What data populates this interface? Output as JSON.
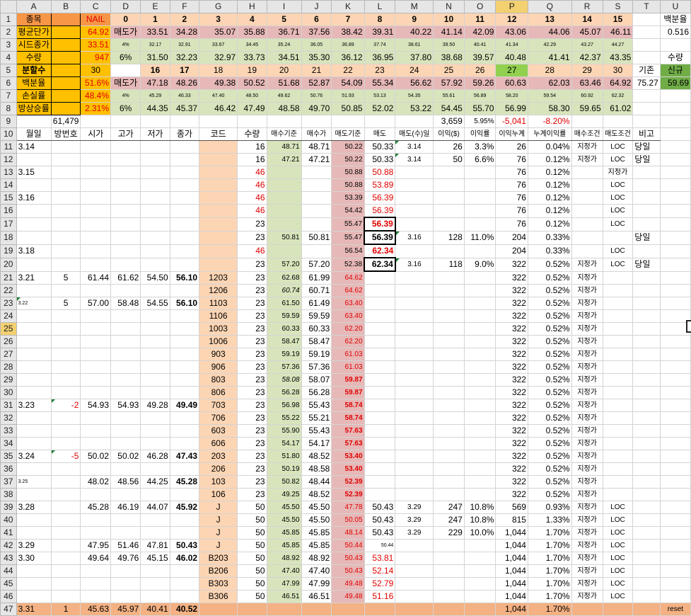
{
  "columns": [
    "A",
    "B",
    "C",
    "D",
    "E",
    "F",
    "G",
    "H",
    "I",
    "J",
    "K",
    "L",
    "M",
    "N",
    "O",
    "P",
    "Q",
    "R",
    "S",
    "T",
    "U"
  ],
  "selected_column": "P",
  "selected_row": "25",
  "colors": {
    "header_orange": "#f79646",
    "yellow": "#ffc000",
    "green": "#92d050",
    "red_text": "#e00000",
    "pink": "#e6b8b7",
    "light_green": "#d8e4bc",
    "peach": "#fcd5b4"
  },
  "rows": [
    {
      "n": "1",
      "c": [
        "종목",
        "",
        "NAIL",
        "0",
        "1",
        "2",
        "3",
        "4",
        "5",
        "6",
        "7",
        "8",
        "9",
        "10",
        "11",
        "12",
        "13",
        "14",
        "15",
        "",
        "백분율"
      ]
    },
    {
      "n": "2",
      "c": [
        "평균단가",
        "",
        "64.92",
        "매도가",
        "33.51",
        "34.28",
        "35.07",
        "35.88",
        "36.71",
        "37.56",
        "38.42",
        "39.31",
        "40.22",
        "41.14",
        "42.09",
        "43.06",
        "44.06",
        "45.07",
        "46.11",
        "",
        "0.516"
      ]
    },
    {
      "n": "3",
      "c": [
        "시드종가",
        "",
        "33.51",
        "4%",
        "32.17",
        "32.91",
        "33.67",
        "34.45",
        "35.24",
        "36.05",
        "36.89",
        "37.74",
        "38.61",
        "39.50",
        "40.41",
        "41.34",
        "42.29",
        "43.27",
        "44.27",
        "",
        ""
      ]
    },
    {
      "n": "4",
      "c": [
        "수량",
        "",
        "947",
        "6%",
        "31.50",
        "32.23",
        "32.97",
        "33.73",
        "34.51",
        "35.30",
        "36.12",
        "36.95",
        "37.80",
        "38.68",
        "39.57",
        "40.48",
        "41.41",
        "42.37",
        "43.35",
        "",
        "수량"
      ]
    },
    {
      "n": "5",
      "c": [
        "분할수",
        "",
        "30",
        "",
        "16",
        "17",
        "18",
        "19",
        "20",
        "21",
        "22",
        "23",
        "24",
        "25",
        "26",
        "27",
        "28",
        "29",
        "30",
        "기존",
        "신규"
      ]
    },
    {
      "n": "6",
      "c": [
        "백분율",
        "",
        "51.6%",
        "매도가",
        "47.18",
        "48.26",
        "49.38",
        "50.52",
        "51.68",
        "52.87",
        "54.09",
        "55.34",
        "56.62",
        "57.92",
        "59.26",
        "60.63",
        "62.03",
        "63.46",
        "64.92",
        "75.27",
        "59.69"
      ]
    },
    {
      "n": "7",
      "c": [
        "손실률",
        "",
        "48.4%",
        "4%",
        "45.29",
        "46.33",
        "47.40",
        "48.50",
        "49.62",
        "50.76",
        "51.93",
        "53.13",
        "54.35",
        "55.61",
        "56.89",
        "58.20",
        "59.54",
        "60.92",
        "62.32",
        "",
        ""
      ]
    },
    {
      "n": "8",
      "c": [
        "방상승률",
        "",
        "2.31%",
        "6%",
        "44.35",
        "45.37",
        "46.42",
        "47.49",
        "48.58",
        "49.70",
        "50.85",
        "52.02",
        "53.22",
        "54.45",
        "55.70",
        "56.99",
        "58.30",
        "59.65",
        "61.02",
        "",
        ""
      ]
    },
    {
      "n": "9",
      "c": [
        "",
        "61,479",
        "",
        "",
        "",
        "",
        "",
        "",
        "",
        "",
        "",
        "",
        "",
        "3,659",
        "5.95%",
        "-5,041",
        "-8.20%",
        "",
        "",
        "",
        ""
      ]
    },
    {
      "n": "10",
      "c": [
        "월일",
        "방번호",
        "시가",
        "고가",
        "저가",
        "종가",
        "코드",
        "수량",
        "매수기준",
        "매수가",
        "매도기준",
        "매도",
        "매도(수)일",
        "이익($)",
        "이익률",
        "이익누계",
        "누계이익률",
        "매수조건",
        "매도조건",
        "비고",
        ""
      ]
    },
    {
      "n": "11",
      "c": [
        "3.14",
        "",
        "",
        "",
        "",
        "",
        "",
        "16",
        "48.71",
        "48.71",
        "50.22",
        "50.33",
        "3.14",
        "26",
        "3.3%",
        "26",
        "0.04%",
        "지정가",
        "LOC",
        "당일",
        ""
      ]
    },
    {
      "n": "12",
      "c": [
        "",
        "",
        "",
        "",
        "",
        "",
        "",
        "16",
        "47.21",
        "47.21",
        "50.22",
        "50.33",
        "3.14",
        "50",
        "6.6%",
        "76",
        "0.12%",
        "지정가",
        "LOC",
        "당일",
        ""
      ]
    },
    {
      "n": "13",
      "c": [
        "3.15",
        "",
        "",
        "",
        "",
        "",
        "",
        "46",
        "",
        "",
        "50.88",
        "50.88",
        "",
        "",
        "",
        "76",
        "0.12%",
        "",
        "지정가",
        "",
        ""
      ]
    },
    {
      "n": "14",
      "c": [
        "",
        "",
        "",
        "",
        "",
        "",
        "",
        "46",
        "",
        "",
        "50.88",
        "53.89",
        "",
        "",
        "",
        "76",
        "0.12%",
        "",
        "LOC",
        "",
        ""
      ]
    },
    {
      "n": "15",
      "c": [
        "3.16",
        "",
        "",
        "",
        "",
        "",
        "",
        "46",
        "",
        "",
        "53.39",
        "56.39",
        "",
        "",
        "",
        "76",
        "0.12%",
        "",
        "LOC",
        "",
        ""
      ]
    },
    {
      "n": "16",
      "c": [
        "",
        "",
        "",
        "",
        "",
        "",
        "",
        "46",
        "",
        "",
        "54.42",
        "56.39",
        "",
        "",
        "",
        "76",
        "0.12%",
        "",
        "LOC",
        "",
        ""
      ]
    },
    {
      "n": "17",
      "c": [
        "",
        "",
        "",
        "",
        "",
        "",
        "",
        "23",
        "",
        "",
        "55.47",
        "56.39",
        "",
        "",
        "",
        "76",
        "0.12%",
        "",
        "LOC",
        "",
        ""
      ]
    },
    {
      "n": "18",
      "c": [
        "",
        "",
        "",
        "",
        "",
        "",
        "",
        "23",
        "50.81",
        "50.81",
        "55.47",
        "56.39",
        "3.16",
        "128",
        "11.0%",
        "204",
        "0.33%",
        "",
        "",
        "당일",
        ""
      ]
    },
    {
      "n": "19",
      "c": [
        "3.18",
        "",
        "",
        "",
        "",
        "",
        "",
        "46",
        "",
        "",
        "56.54",
        "62.34",
        "",
        "",
        "",
        "204",
        "0.33%",
        "",
        "LOC",
        "",
        ""
      ]
    },
    {
      "n": "20",
      "c": [
        "",
        "",
        "",
        "",
        "",
        "",
        "",
        "23",
        "57.20",
        "57.20",
        "52.38",
        "62.34",
        "3.16",
        "118",
        "9.0%",
        "322",
        "0.52%",
        "지정가",
        "LOC",
        "당일",
        ""
      ]
    },
    {
      "n": "21",
      "c": [
        "3.21",
        "5",
        "61.44",
        "61.62",
        "54.50",
        "56.10",
        "1203",
        "23",
        "62.68",
        "61.99",
        "64.62",
        "",
        "",
        "",
        "",
        "322",
        "0.52%",
        "지정가",
        "",
        "",
        ""
      ]
    },
    {
      "n": "22",
      "c": [
        "",
        "",
        "",
        "",
        "",
        "",
        "1206",
        "23",
        "60.74",
        "60.71",
        "64.62",
        "",
        "",
        "",
        "",
        "322",
        "0.52%",
        "지정가",
        "",
        "",
        ""
      ]
    },
    {
      "n": "23",
      "c": [
        "3.22",
        "5",
        "57.00",
        "58.48",
        "54.55",
        "56.10",
        "1103",
        "23",
        "61.50",
        "61.49",
        "63.40",
        "",
        "",
        "",
        "",
        "322",
        "0.52%",
        "지정가",
        "",
        "",
        ""
      ]
    },
    {
      "n": "24",
      "c": [
        "",
        "",
        "",
        "",
        "",
        "",
        "1106",
        "23",
        "59.59",
        "59.59",
        "63.40",
        "",
        "",
        "",
        "",
        "322",
        "0.52%",
        "지정가",
        "",
        "",
        ""
      ]
    },
    {
      "n": "25",
      "c": [
        "",
        "",
        "",
        "",
        "",
        "",
        "1003",
        "23",
        "60.33",
        "60.33",
        "62.20",
        "",
        "",
        "",
        "",
        "322",
        "0.52%",
        "지정가",
        "",
        "",
        ""
      ]
    },
    {
      "n": "26",
      "c": [
        "",
        "",
        "",
        "",
        "",
        "",
        "1006",
        "23",
        "58.47",
        "58.47",
        "62.20",
        "",
        "",
        "",
        "",
        "322",
        "0.52%",
        "지정가",
        "",
        "",
        ""
      ]
    },
    {
      "n": "27",
      "c": [
        "",
        "",
        "",
        "",
        "",
        "",
        "903",
        "23",
        "59.19",
        "59.19",
        "61.03",
        "",
        "",
        "",
        "",
        "322",
        "0.52%",
        "지정가",
        "",
        "",
        ""
      ]
    },
    {
      "n": "28",
      "c": [
        "",
        "",
        "",
        "",
        "",
        "",
        "906",
        "23",
        "57.36",
        "57.36",
        "61.03",
        "",
        "",
        "",
        "",
        "322",
        "0.52%",
        "지정가",
        "",
        "",
        ""
      ]
    },
    {
      "n": "29",
      "c": [
        "",
        "",
        "",
        "",
        "",
        "",
        "803",
        "23",
        "58.08",
        "58.07",
        "59.87",
        "",
        "",
        "",
        "",
        "322",
        "0.52%",
        "지정가",
        "",
        "",
        ""
      ]
    },
    {
      "n": "30",
      "c": [
        "",
        "",
        "",
        "",
        "",
        "",
        "806",
        "23",
        "56.28",
        "56.28",
        "59.87",
        "",
        "",
        "",
        "",
        "322",
        "0.52%",
        "지정가",
        "",
        "",
        ""
      ]
    },
    {
      "n": "31",
      "c": [
        "3.23",
        "-2",
        "54.93",
        "54.93",
        "49.28",
        "49.49",
        "703",
        "23",
        "56.98",
        "55.43",
        "58.74",
        "",
        "",
        "",
        "",
        "322",
        "0.52%",
        "지정가",
        "",
        "",
        ""
      ]
    },
    {
      "n": "32",
      "c": [
        "",
        "",
        "",
        "",
        "",
        "",
        "706",
        "23",
        "55.22",
        "55.21",
        "58.74",
        "",
        "",
        "",
        "",
        "322",
        "0.52%",
        "지정가",
        "",
        "",
        ""
      ]
    },
    {
      "n": "33",
      "c": [
        "",
        "",
        "",
        "",
        "",
        "",
        "603",
        "23",
        "55.90",
        "55.43",
        "57.63",
        "",
        "",
        "",
        "",
        "322",
        "0.52%",
        "지정가",
        "",
        "",
        ""
      ]
    },
    {
      "n": "34",
      "c": [
        "",
        "",
        "",
        "",
        "",
        "",
        "606",
        "23",
        "54.17",
        "54.17",
        "57.63",
        "",
        "",
        "",
        "",
        "322",
        "0.52%",
        "지정가",
        "",
        "",
        ""
      ]
    },
    {
      "n": "35",
      "c": [
        "3.24",
        "-5",
        "50.02",
        "50.02",
        "46.28",
        "47.43",
        "203",
        "23",
        "51.80",
        "48.52",
        "53.40",
        "",
        "",
        "",
        "",
        "322",
        "0.52%",
        "지정가",
        "",
        "",
        ""
      ]
    },
    {
      "n": "36",
      "c": [
        "",
        "",
        "",
        "",
        "",
        "",
        "206",
        "23",
        "50.19",
        "48.58",
        "53.40",
        "",
        "",
        "",
        "",
        "322",
        "0.52%",
        "지정가",
        "",
        "",
        ""
      ]
    },
    {
      "n": "37",
      "c": [
        "3.25",
        "",
        "48.02",
        "48.56",
        "44.25",
        "45.28",
        "103",
        "23",
        "50.82",
        "48.44",
        "52.39",
        "",
        "",
        "",
        "",
        "322",
        "0.52%",
        "지정가",
        "",
        "",
        ""
      ]
    },
    {
      "n": "38",
      "c": [
        "",
        "",
        "",
        "",
        "",
        "",
        "106",
        "23",
        "49.25",
        "48.52",
        "52.39",
        "",
        "",
        "",
        "",
        "322",
        "0.52%",
        "지정가",
        "",
        "",
        ""
      ]
    },
    {
      "n": "39",
      "c": [
        "3.28",
        "",
        "45.28",
        "46.19",
        "44.07",
        "45.92",
        "J",
        "50",
        "45.50",
        "45.50",
        "47.78",
        "50.43",
        "3.29",
        "247",
        "10.8%",
        "569",
        "0.93%",
        "지정가",
        "LOC",
        "",
        ""
      ]
    },
    {
      "n": "40",
      "c": [
        "",
        "",
        "",
        "",
        "",
        "",
        "J",
        "50",
        "45.50",
        "45.50",
        "50.05",
        "50.43",
        "3.29",
        "247",
        "10.8%",
        "815",
        "1.33%",
        "지정가",
        "LOC",
        "",
        ""
      ]
    },
    {
      "n": "41",
      "c": [
        "",
        "",
        "",
        "",
        "",
        "",
        "J",
        "50",
        "45.85",
        "45.85",
        "48.14",
        "50.43",
        "3.29",
        "229",
        "10.0%",
        "1,044",
        "1.70%",
        "지정가",
        "LOC",
        "",
        ""
      ]
    },
    {
      "n": "42",
      "c": [
        "3.29",
        "",
        "47.95",
        "51.46",
        "47.81",
        "50.43",
        "J",
        "50",
        "45.85",
        "45.85",
        "50.44",
        "50.44",
        "",
        "",
        "",
        "1,044",
        "1.70%",
        "지정가",
        "LOC",
        "",
        ""
      ]
    },
    {
      "n": "43",
      "c": [
        "3.30",
        "",
        "49.64",
        "49.76",
        "45.15",
        "46.02",
        "B203",
        "50",
        "48.92",
        "48.92",
        "50.43",
        "53.81",
        "",
        "",
        "",
        "1,044",
        "1.70%",
        "지정가",
        "LOC",
        "",
        ""
      ]
    },
    {
      "n": "44",
      "c": [
        "",
        "",
        "",
        "",
        "",
        "",
        "B206",
        "50",
        "47.40",
        "47.40",
        "50.43",
        "52.14",
        "",
        "",
        "",
        "1,044",
        "1.70%",
        "지정가",
        "LOC",
        "",
        ""
      ]
    },
    {
      "n": "45",
      "c": [
        "",
        "",
        "",
        "",
        "",
        "",
        "B303",
        "50",
        "47.99",
        "47.99",
        "49.48",
        "52.79",
        "",
        "",
        "",
        "1,044",
        "1.70%",
        "지정가",
        "LOC",
        "",
        ""
      ]
    },
    {
      "n": "46",
      "c": [
        "",
        "",
        "",
        "",
        "",
        "",
        "B306",
        "50",
        "46.51",
        "46.51",
        "49.48",
        "51.16",
        "",
        "",
        "",
        "1,044",
        "1.70%",
        "지정가",
        "LOC",
        "",
        ""
      ]
    },
    {
      "n": "47",
      "c": [
        "3.31",
        "1",
        "45.63",
        "45.97",
        "40.41",
        "40.52",
        "",
        "",
        "",
        "",
        "",
        "",
        "",
        "",
        "",
        "1,044",
        "1.70%",
        "",
        "",
        "",
        "reset"
      ]
    }
  ]
}
